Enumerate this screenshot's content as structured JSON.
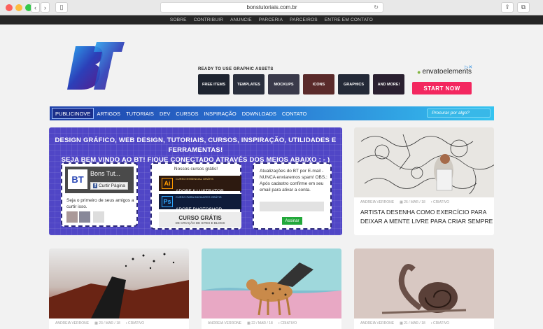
{
  "browser": {
    "url": "bonstutoriais.com.br",
    "back_icon": "chevron-left-icon",
    "forward_icon": "chevron-right-icon"
  },
  "topnav": [
    "SOBRE",
    "CONTRIBUIR",
    "ANUNCIE",
    "PARCERIA",
    "PARCEIROS",
    "ENTRE EM CONTATO"
  ],
  "header": {
    "logo_text": "BT",
    "ad": {
      "title": "READY TO USE GRAPHIC ASSETS",
      "assets": [
        "FREE ITEMS",
        "TEMPLATES",
        "MOCKUPS",
        "ICONS",
        "GRAPHICS",
        "AND MORE!"
      ],
      "brand": "envatoelements",
      "cta": "START NOW",
      "adchoices": "▷✕"
    }
  },
  "mainnav": {
    "items": [
      "PUBLICINOVE",
      "ARTIGOS",
      "TUTORIAIS",
      "DEV",
      "CURSOS",
      "INSPIRAÇÃO",
      "DOWNLOADS",
      "CONTATO"
    ],
    "search_placeholder": "Procurar por algo?"
  },
  "welcome": {
    "line1": "DESIGN GRÁFICO, WEB DESIGN, TUTORIAIS, CURSOS, INSPIRAÇÃO, UTILIDADES E FERRAMENTAS!",
    "line2": "SEJA BEM VINDO AO BT! FIQUE CONECTADO ATRAVÉS DOS MEIOS ABAIXO ; - )",
    "facebook": {
      "logo": "BT",
      "page_name": "Bons Tut...",
      "like": "Curtir Página",
      "text": "Seja o primeiro de seus amigos a curtir isso."
    },
    "courses": {
      "title": "Nossos cursos grátis!",
      "items": [
        {
          "icon": "Ai",
          "small": "CURSO ESSENCIAL GRÁTIS",
          "name": "ADOBE ILLUSTRATOR"
        },
        {
          "icon": "Ps",
          "small": "CURSO PARA INICIANTES GRÁTIS",
          "name": "ADOBE PHOTOSHOP"
        },
        {
          "icon": "",
          "small": "DE CRIAÇÃO DE SITES E BLOGS",
          "name": "CURSO GRÁTIS"
        }
      ]
    },
    "subscribe": {
      "text": "Atualizações do BT por E-mail - NUNCA enviaremos spam! OBS.: Após cadastro confirme em seu email para ativar a conta.",
      "button": "Assinar"
    }
  },
  "posts": [
    {
      "author": "ANDREIA VERRONE",
      "date": "26 / MAR / 18",
      "category": "CRIATIVO",
      "title": "ARTISTA DESENHA COMO EXERCÍCIO PARA DEIXAR A MENTE LIVRE PARA CRIAR SEMPRE"
    },
    {
      "author": "ANDREIA VERRONE",
      "date": "23 / MAR / 18",
      "category": "CRIATIVO",
      "title": ""
    },
    {
      "author": "ANDREIA VERRONE",
      "date": "22 / MAR / 18",
      "category": "CRIATIVO",
      "title": ""
    },
    {
      "author": "ANDREIA VERRONE",
      "date": "21 / MAR / 18",
      "category": "CRIATIVO",
      "title": ""
    }
  ]
}
